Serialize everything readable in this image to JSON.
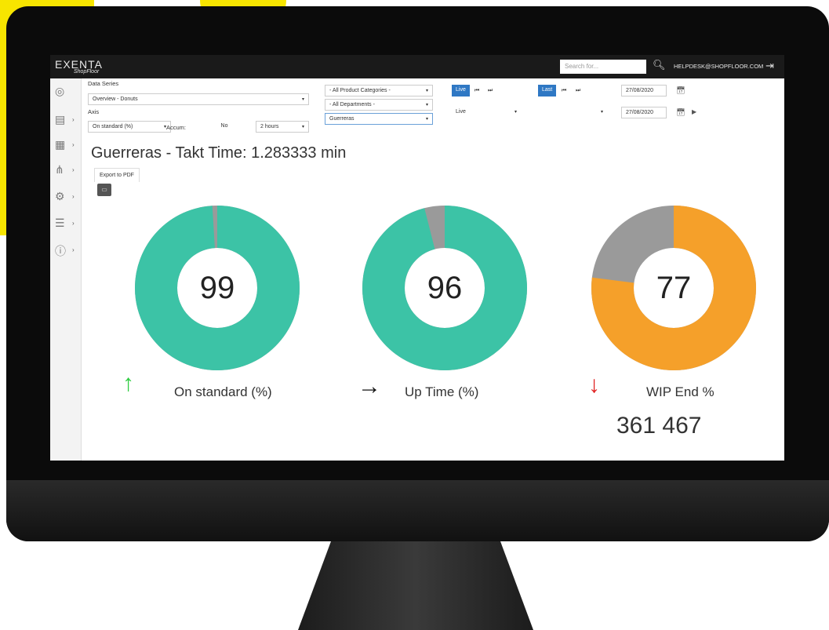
{
  "app": {
    "logo": "EXENTA",
    "logo_sub": "ShopFloor",
    "search_placeholder": "Search for...",
    "helpdesk": "HELPDESK@SHOPFLOOR.COM"
  },
  "sidebar": {
    "items": [
      {
        "icon": "dashboard-icon",
        "glyph": "◎"
      },
      {
        "icon": "machines-icon",
        "glyph": "▤"
      },
      {
        "icon": "screen-icon",
        "glyph": "▦"
      },
      {
        "icon": "hierarchy-icon",
        "glyph": "⋔"
      },
      {
        "icon": "settings-icon",
        "glyph": "⚙"
      },
      {
        "icon": "database-icon",
        "glyph": "☰"
      },
      {
        "icon": "help-icon",
        "glyph": "?"
      }
    ]
  },
  "filters": {
    "data_series_label": "Data Series",
    "data_series_value": "Overview - Donuts",
    "axis_label": "Axis",
    "axis_value": "On standard (%)",
    "accum_label": "Accum:",
    "accum_value": "No",
    "interval_value": "2 hours",
    "product_categories": "- All Product Categories -",
    "departments": "- All Departments -",
    "line_value": "Guerreras",
    "live_button": "Live",
    "live_select": "Live",
    "last_button": "Last",
    "empty_select": "",
    "date_from": "27/08/2020",
    "date_to": "27/08/2020"
  },
  "page": {
    "title": "Guerreras - Takt Time: 1.283333 min",
    "export_pdf": "Export to PDF"
  },
  "metrics": [
    {
      "label": "On standard (%)",
      "value": "99",
      "percent": 99,
      "trend": "up",
      "trend_glyph": "↑",
      "color": "#3cc3a6"
    },
    {
      "label": "Up Time (%)",
      "value": "96",
      "percent": 96,
      "trend": "flat",
      "trend_glyph": "→",
      "color": "#3cc3a6"
    },
    {
      "label": "WIP End %",
      "value": "77",
      "percent": 77,
      "trend": "down",
      "trend_glyph": "↓",
      "color": "#f5a02a",
      "total": "361 467"
    }
  ],
  "colors": {
    "teal": "#3cc3a6",
    "orange": "#f5a02a",
    "remainder": "#9a9a9a",
    "up": "#2ecc40",
    "flat": "#111111",
    "down": "#e02020",
    "accent": "#2f78c4"
  }
}
